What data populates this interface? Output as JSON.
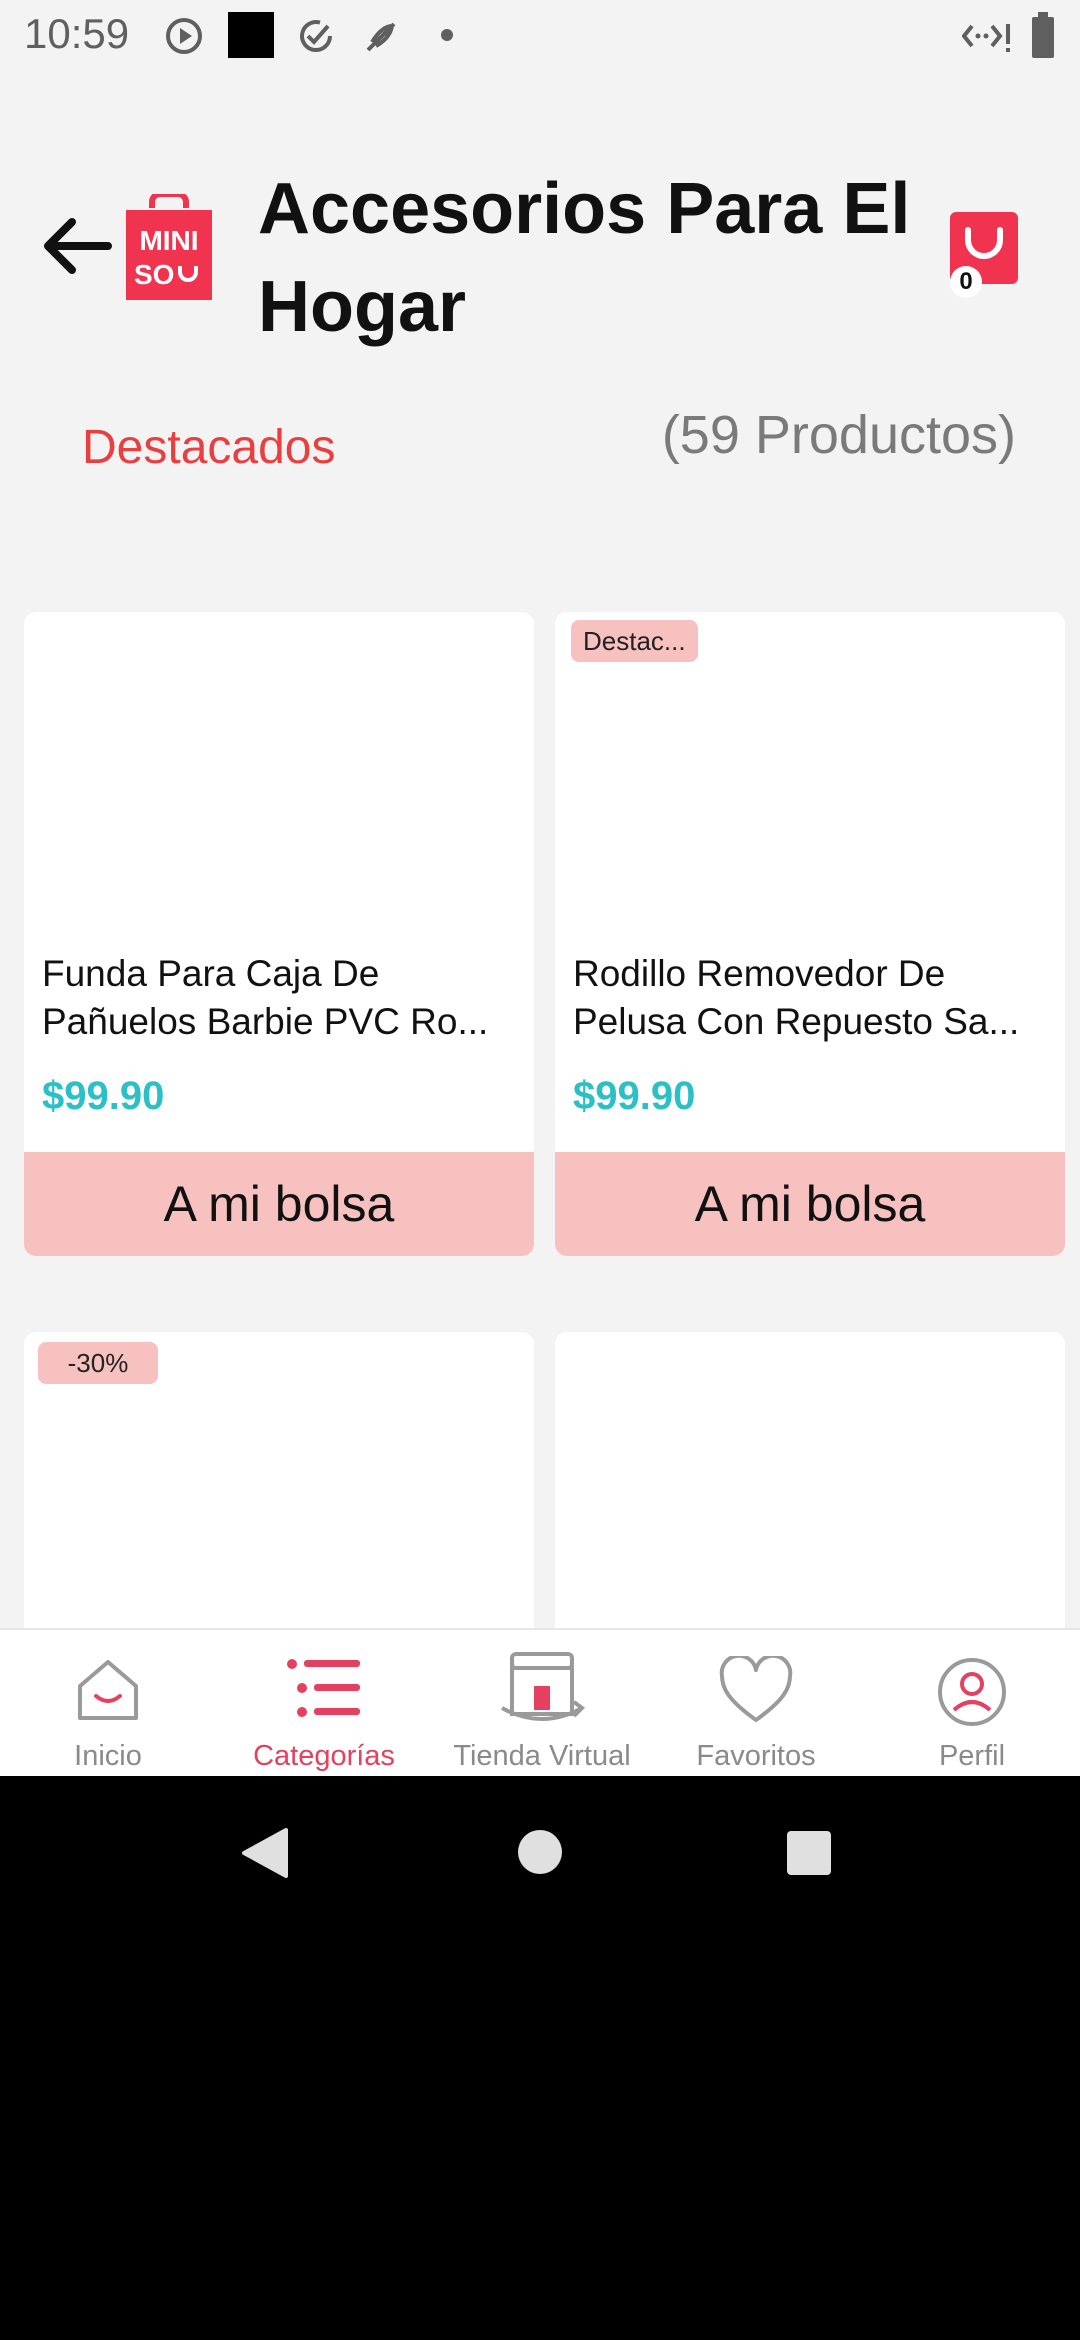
{
  "status_bar": {
    "time": "10:59",
    "icons": [
      "play-circle-icon",
      "black-square-icon",
      "check-circle-icon",
      "leaf-icon",
      "dot-icon",
      "network-icon",
      "battery-icon"
    ]
  },
  "header": {
    "title_line1": "Accesorios Para El",
    "title_line2": "Hogar",
    "logo_line1": "MINI",
    "logo_line2": "SO",
    "cart_count": "0",
    "brand_color": "#f0334f"
  },
  "sort": {
    "label": "Destacados",
    "count_text": "(59 Productos)"
  },
  "products": [
    {
      "badge": "",
      "name_line1": "Funda Para Caja De",
      "name_line2": "Pañuelos Barbie PVC Ro...",
      "price": "$99.90",
      "button": "A mi bolsa"
    },
    {
      "badge": "Destac...",
      "name_line1": "Rodillo Removedor De",
      "name_line2": "Pelusa Con Repuesto Sa...",
      "price": "$99.90",
      "button": "A mi bolsa"
    },
    {
      "badge": "-30%"
    },
    {
      "badge": ""
    }
  ],
  "bottom_nav": {
    "items": [
      {
        "label": "Inicio",
        "active": false
      },
      {
        "label": "Categorías",
        "active": true
      },
      {
        "label": "Tienda Virtual",
        "active": false
      },
      {
        "label": "Favoritos",
        "active": false
      },
      {
        "label": "Perfil",
        "active": false
      }
    ],
    "active_color": "#e4405f"
  },
  "colors": {
    "price": "#2bbfc6",
    "badge_bg": "#f6c1be",
    "sort_label": "#e84040"
  }
}
